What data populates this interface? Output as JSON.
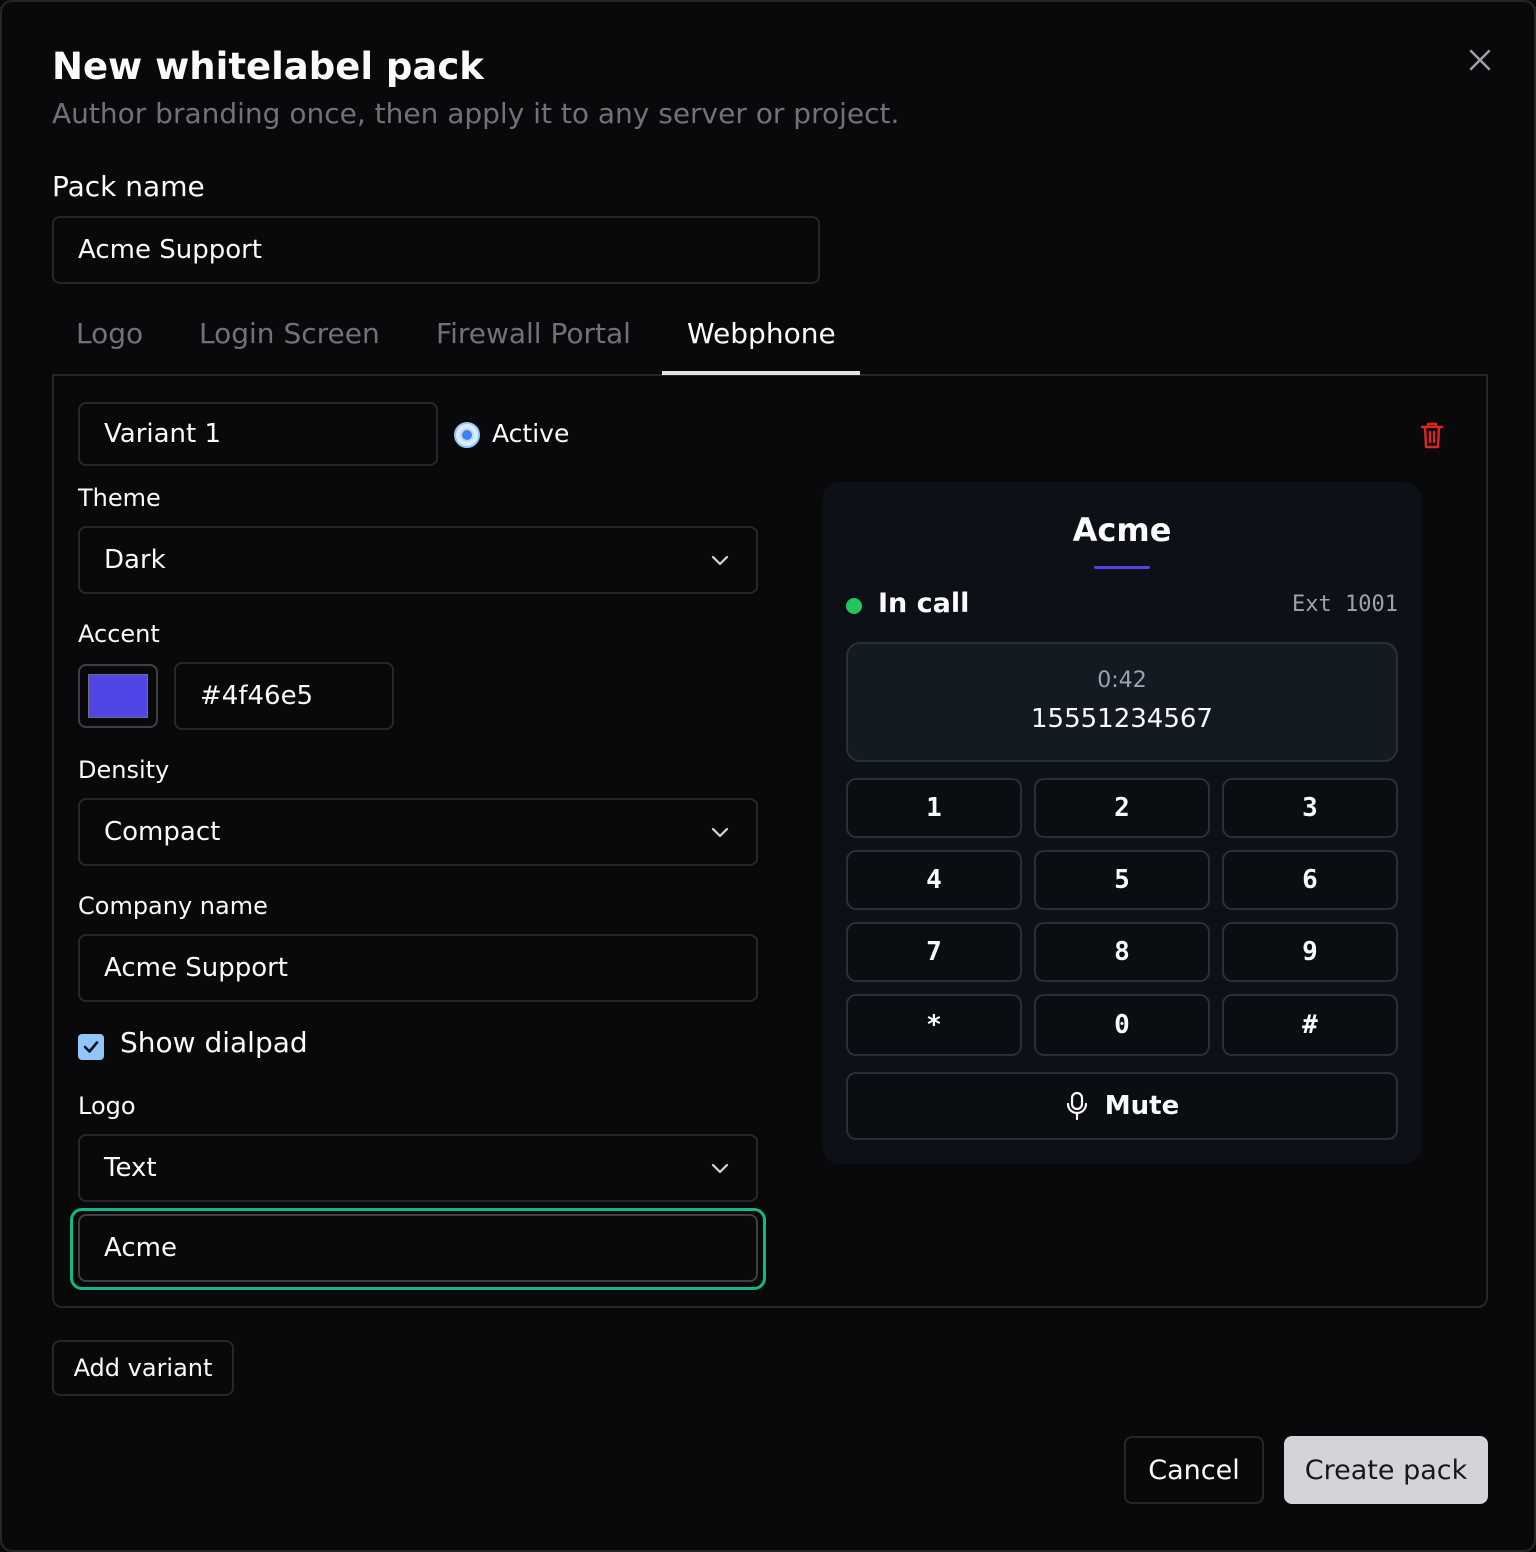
{
  "dialog": {
    "title": "New whitelabel pack",
    "subtitle": "Author branding once, then apply it to any server or project."
  },
  "pack_name": {
    "label": "Pack name",
    "value": "Acme Support"
  },
  "tabs": [
    {
      "label": "Logo",
      "active": false
    },
    {
      "label": "Login Screen",
      "active": false
    },
    {
      "label": "Firewall Portal",
      "active": false
    },
    {
      "label": "Webphone",
      "active": true
    }
  ],
  "variant": {
    "name": "Variant 1",
    "active_label": "Active",
    "active": true
  },
  "form": {
    "theme": {
      "label": "Theme",
      "value": "Dark"
    },
    "accent": {
      "label": "Accent",
      "value": "#4f46e5",
      "swatch_color": "#4f46e5"
    },
    "density": {
      "label": "Density",
      "value": "Compact"
    },
    "company": {
      "label": "Company name",
      "value": "Acme Support"
    },
    "show_dialpad": {
      "label": "Show dialpad",
      "checked": true
    },
    "logo": {
      "label": "Logo",
      "type": "Text",
      "text_value": "Acme"
    }
  },
  "preview": {
    "brand": "Acme",
    "status": "In call",
    "status_color": "#22c55e",
    "extension": "Ext 1001",
    "timer": "0:42",
    "number": "15551234567",
    "keys": [
      "1",
      "2",
      "3",
      "4",
      "5",
      "6",
      "7",
      "8",
      "9",
      "*",
      "0",
      "#"
    ],
    "mute_label": "Mute"
  },
  "actions": {
    "add_variant": "Add variant",
    "cancel": "Cancel",
    "create": "Create pack"
  },
  "icons": {
    "close": "close-icon",
    "delete": "trash-icon",
    "chevron": "chevron-down-icon",
    "check": "check-icon",
    "mic": "microphone-icon"
  }
}
